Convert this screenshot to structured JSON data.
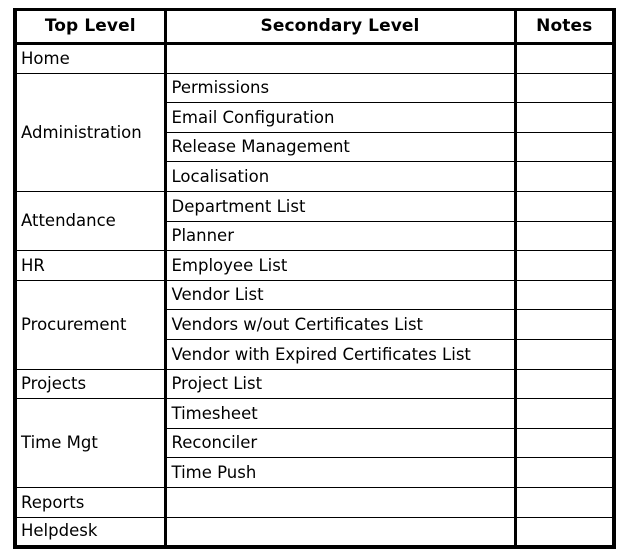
{
  "table": {
    "columns": [
      {
        "key": "top_level",
        "label": "Top Level"
      },
      {
        "key": "secondary_level",
        "label": "Secondary Level"
      },
      {
        "key": "notes",
        "label": "Notes"
      }
    ],
    "groups": [
      {
        "top_level": "Home",
        "secondary": [
          ""
        ]
      },
      {
        "top_level": "Administration",
        "secondary": [
          "Permissions",
          "Email Configuration",
          "Release Management",
          "Localisation"
        ]
      },
      {
        "top_level": "Attendance",
        "secondary": [
          "Department List",
          "Planner"
        ]
      },
      {
        "top_level": "HR",
        "secondary": [
          "Employee List"
        ]
      },
      {
        "top_level": "Procurement",
        "secondary": [
          "Vendor List",
          "Vendors w/out Certificates List",
          "Vendor with Expired Certificates List"
        ]
      },
      {
        "top_level": "Projects",
        "secondary": [
          "Project List"
        ]
      },
      {
        "top_level": "Time Mgt",
        "secondary": [
          "Timesheet",
          "Reconciler",
          "Time Push"
        ]
      },
      {
        "top_level": "Reports",
        "secondary": [
          ""
        ]
      },
      {
        "top_level": "Helpdesk",
        "secondary": [
          ""
        ]
      }
    ],
    "rows": [
      {
        "top_level": "Home",
        "rowspan": 1,
        "secondary_level": "",
        "notes": ""
      },
      {
        "top_level": "Administration",
        "rowspan": 4,
        "secondary_level": "Permissions",
        "notes": ""
      },
      {
        "top_level": null,
        "rowspan": 0,
        "secondary_level": "Email Configuration",
        "notes": ""
      },
      {
        "top_level": null,
        "rowspan": 0,
        "secondary_level": "Release Management",
        "notes": ""
      },
      {
        "top_level": null,
        "rowspan": 0,
        "secondary_level": "Localisation",
        "notes": ""
      },
      {
        "top_level": "Attendance",
        "rowspan": 2,
        "secondary_level": "Department List",
        "notes": ""
      },
      {
        "top_level": null,
        "rowspan": 0,
        "secondary_level": "Planner",
        "notes": ""
      },
      {
        "top_level": "HR",
        "rowspan": 1,
        "secondary_level": "Employee List",
        "notes": ""
      },
      {
        "top_level": "Procurement",
        "rowspan": 3,
        "secondary_level": "Vendor List",
        "notes": ""
      },
      {
        "top_level": null,
        "rowspan": 0,
        "secondary_level": "Vendors w/out Certificates List",
        "notes": ""
      },
      {
        "top_level": null,
        "rowspan": 0,
        "secondary_level": "Vendor with Expired Certificates List",
        "notes": ""
      },
      {
        "top_level": "Projects",
        "rowspan": 1,
        "secondary_level": "Project List",
        "notes": ""
      },
      {
        "top_level": "Time Mgt",
        "rowspan": 3,
        "secondary_level": "Timesheet",
        "notes": ""
      },
      {
        "top_level": null,
        "rowspan": 0,
        "secondary_level": "Reconciler",
        "notes": ""
      },
      {
        "top_level": null,
        "rowspan": 0,
        "secondary_level": "Time Push",
        "notes": ""
      },
      {
        "top_level": "Reports",
        "rowspan": 1,
        "secondary_level": "",
        "notes": ""
      },
      {
        "top_level": "Helpdesk",
        "rowspan": 1,
        "secondary_level": "",
        "notes": ""
      }
    ]
  },
  "style": {
    "border_color": "#000000",
    "background_color": "#ffffff",
    "text_color": "#000000"
  }
}
